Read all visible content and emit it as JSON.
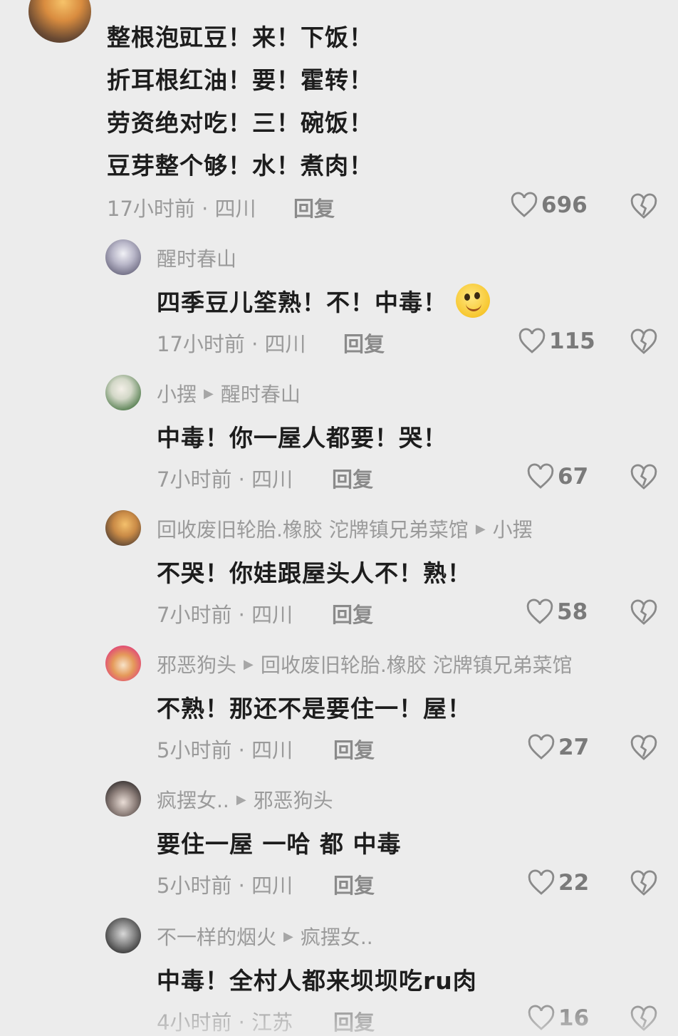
{
  "top_comment": {
    "lines": [
      "整根泡豇豆！来！下饭！",
      "折耳根红油！要！霍转！",
      "劳资绝对吃！三！碗饭！",
      "豆芽整个够！水！煮肉！"
    ],
    "meta": "17小时前 · 四川",
    "reply_label": "回复",
    "likes": "696"
  },
  "replies": [
    {
      "user": "醒时春山",
      "to": "",
      "text": "四季豆儿筌熟！不！中毒！",
      "emoji": "smiley-emoji-icon",
      "meta": "17小时前 · 四川",
      "reply_label": "回复",
      "likes": "115"
    },
    {
      "user": "小摆",
      "to": "醒时春山",
      "text": "中毒！你一屋人都要！哭！",
      "meta": "7小时前 · 四川",
      "reply_label": "回复",
      "likes": "67"
    },
    {
      "user": "回收废旧轮胎.橡胶  沱牌镇兄弟菜馆",
      "to": "小摆",
      "text": "不哭！你娃跟屋头人不！熟！",
      "meta": "7小时前 · 四川",
      "reply_label": "回复",
      "likes": "58"
    },
    {
      "user": "邪恶狗头",
      "to": "回收废旧轮胎.橡胶  沱牌镇兄弟菜馆",
      "text": "不熟！那还不是要住一！屋！",
      "meta": "5小时前 · 四川",
      "reply_label": "回复",
      "likes": "27"
    },
    {
      "user": "疯摆女..",
      "to": "邪恶狗头",
      "text": "要住一屋 一哈 都 中毒",
      "meta": "5小时前 · 四川",
      "reply_label": "回复",
      "likes": "22"
    },
    {
      "user": "不一样的烟火",
      "to": "疯摆女..",
      "text": "中毒！全村人都来坝坝吃ru肉",
      "meta": "4小时前 · 江苏",
      "reply_label": "回复",
      "likes": "16"
    }
  ],
  "colors": {
    "background": "#ececec",
    "text": "#1d1d1d",
    "meta": "#9a9a9a"
  }
}
